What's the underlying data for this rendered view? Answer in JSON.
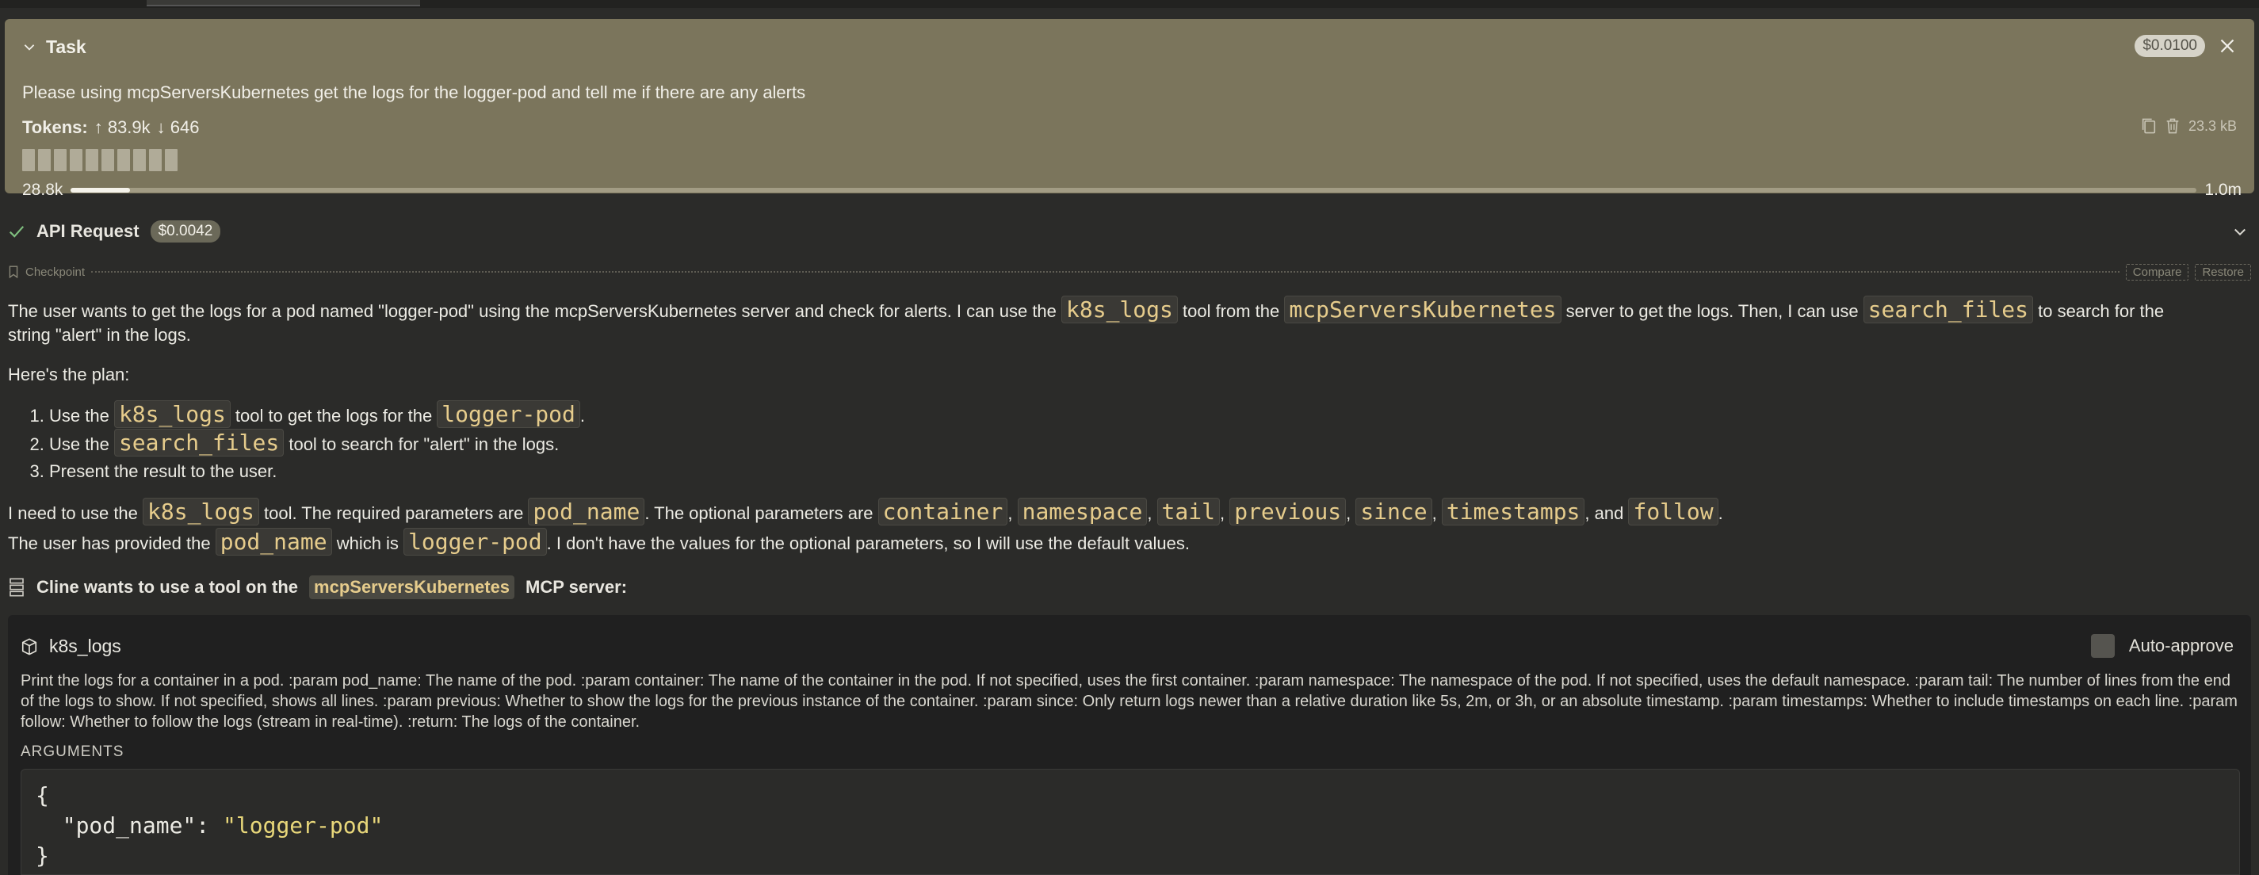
{
  "task": {
    "title": "Task",
    "text": "Please using mcpServersKubernetes get the logs for the logger-pod and tell me if there are any alerts",
    "tokens_label": "Tokens:",
    "tokens_up": "↑ 83.9k",
    "tokens_down": "↓ 646",
    "cost": "$0.0100",
    "size": "23.3 kB",
    "context_used": "28.8k",
    "context_max": "1.0m",
    "context_fraction": 0.028
  },
  "api_request": {
    "title": "API Request",
    "cost": "$0.0042"
  },
  "checkpoint": {
    "label": "Checkpoint",
    "compare": "Compare",
    "restore": "Restore"
  },
  "message": {
    "p1": {
      "a": "The user wants to get the logs for a pod named \"logger-pod\" using the mcpServersKubernetes server and check for alerts. I can use the ",
      "c1": "k8s_logs",
      "b": " tool from the ",
      "c2": "mcpServersKubernetes",
      "c": " server to get the logs. Then, I can use ",
      "c3": "search_files",
      "d": " to search for the",
      "e": "string \"alert\" in the logs."
    },
    "p2": "Here's the plan:",
    "steps": [
      {
        "a": "Use the ",
        "code": "k8s_logs",
        "b": " tool to get the logs for the ",
        "code2": "logger-pod",
        "c": "."
      },
      {
        "a": "Use the ",
        "code": "search_files",
        "b": " tool to search for \"alert\" in the logs."
      },
      {
        "a": "Present the result to the user."
      }
    ],
    "p3": {
      "a": "I need to use the ",
      "c1": "k8s_logs",
      "b": " tool. The required parameters are ",
      "c2": "pod_name",
      "c": ". The optional parameters are ",
      "o1": "container",
      "o2": "namespace",
      "o3": "tail",
      "o4": "previous",
      "o5": "since",
      "o6": "timestamps",
      "and": ", and ",
      "o7": "follow",
      "end": "."
    },
    "p4": {
      "a": "The user has provided the ",
      "c1": "pod_name",
      "b": " which is ",
      "c2": "logger-pod",
      "c": ". I don't have the values for the optional parameters, so I will use the default values."
    }
  },
  "cline": {
    "prefix": "Cline wants to use a tool on the",
    "server": "mcpServersKubernetes",
    "suffix": "MCP server:"
  },
  "tool": {
    "name": "k8s_logs",
    "auto_approve": "Auto-approve",
    "description": "Print the logs for a container in a pod. :param pod_name: The name of the pod. :param container: The name of the container in the pod. If not specified, uses the first container. :param namespace: The namespace of the pod. If not specified, uses the default namespace. :param tail: The number of lines from the end of the logs to show. If not specified, shows all lines. :param previous: Whether to show the logs for the previous instance of the container. :param since: Only return logs newer than a relative duration like 5s, 2m, or 3h, or an absolute timestamp. :param timestamps: Whether to include timestamps on each line. :param follow: Whether to follow the logs (stream in real-time). :return: The logs of the container.",
    "arguments_label": "ARGUMENTS",
    "args": {
      "open": "{",
      "key": "\"pod_name\"",
      "colon": ": ",
      "value": "\"logger-pod\"",
      "close": "}"
    }
  },
  "colors": {
    "background": "#2b2b29",
    "task_panel": "#7b755c",
    "code_text": "#e6cc8c",
    "json_string": "#e8d77a",
    "tool_card": "#202020"
  }
}
